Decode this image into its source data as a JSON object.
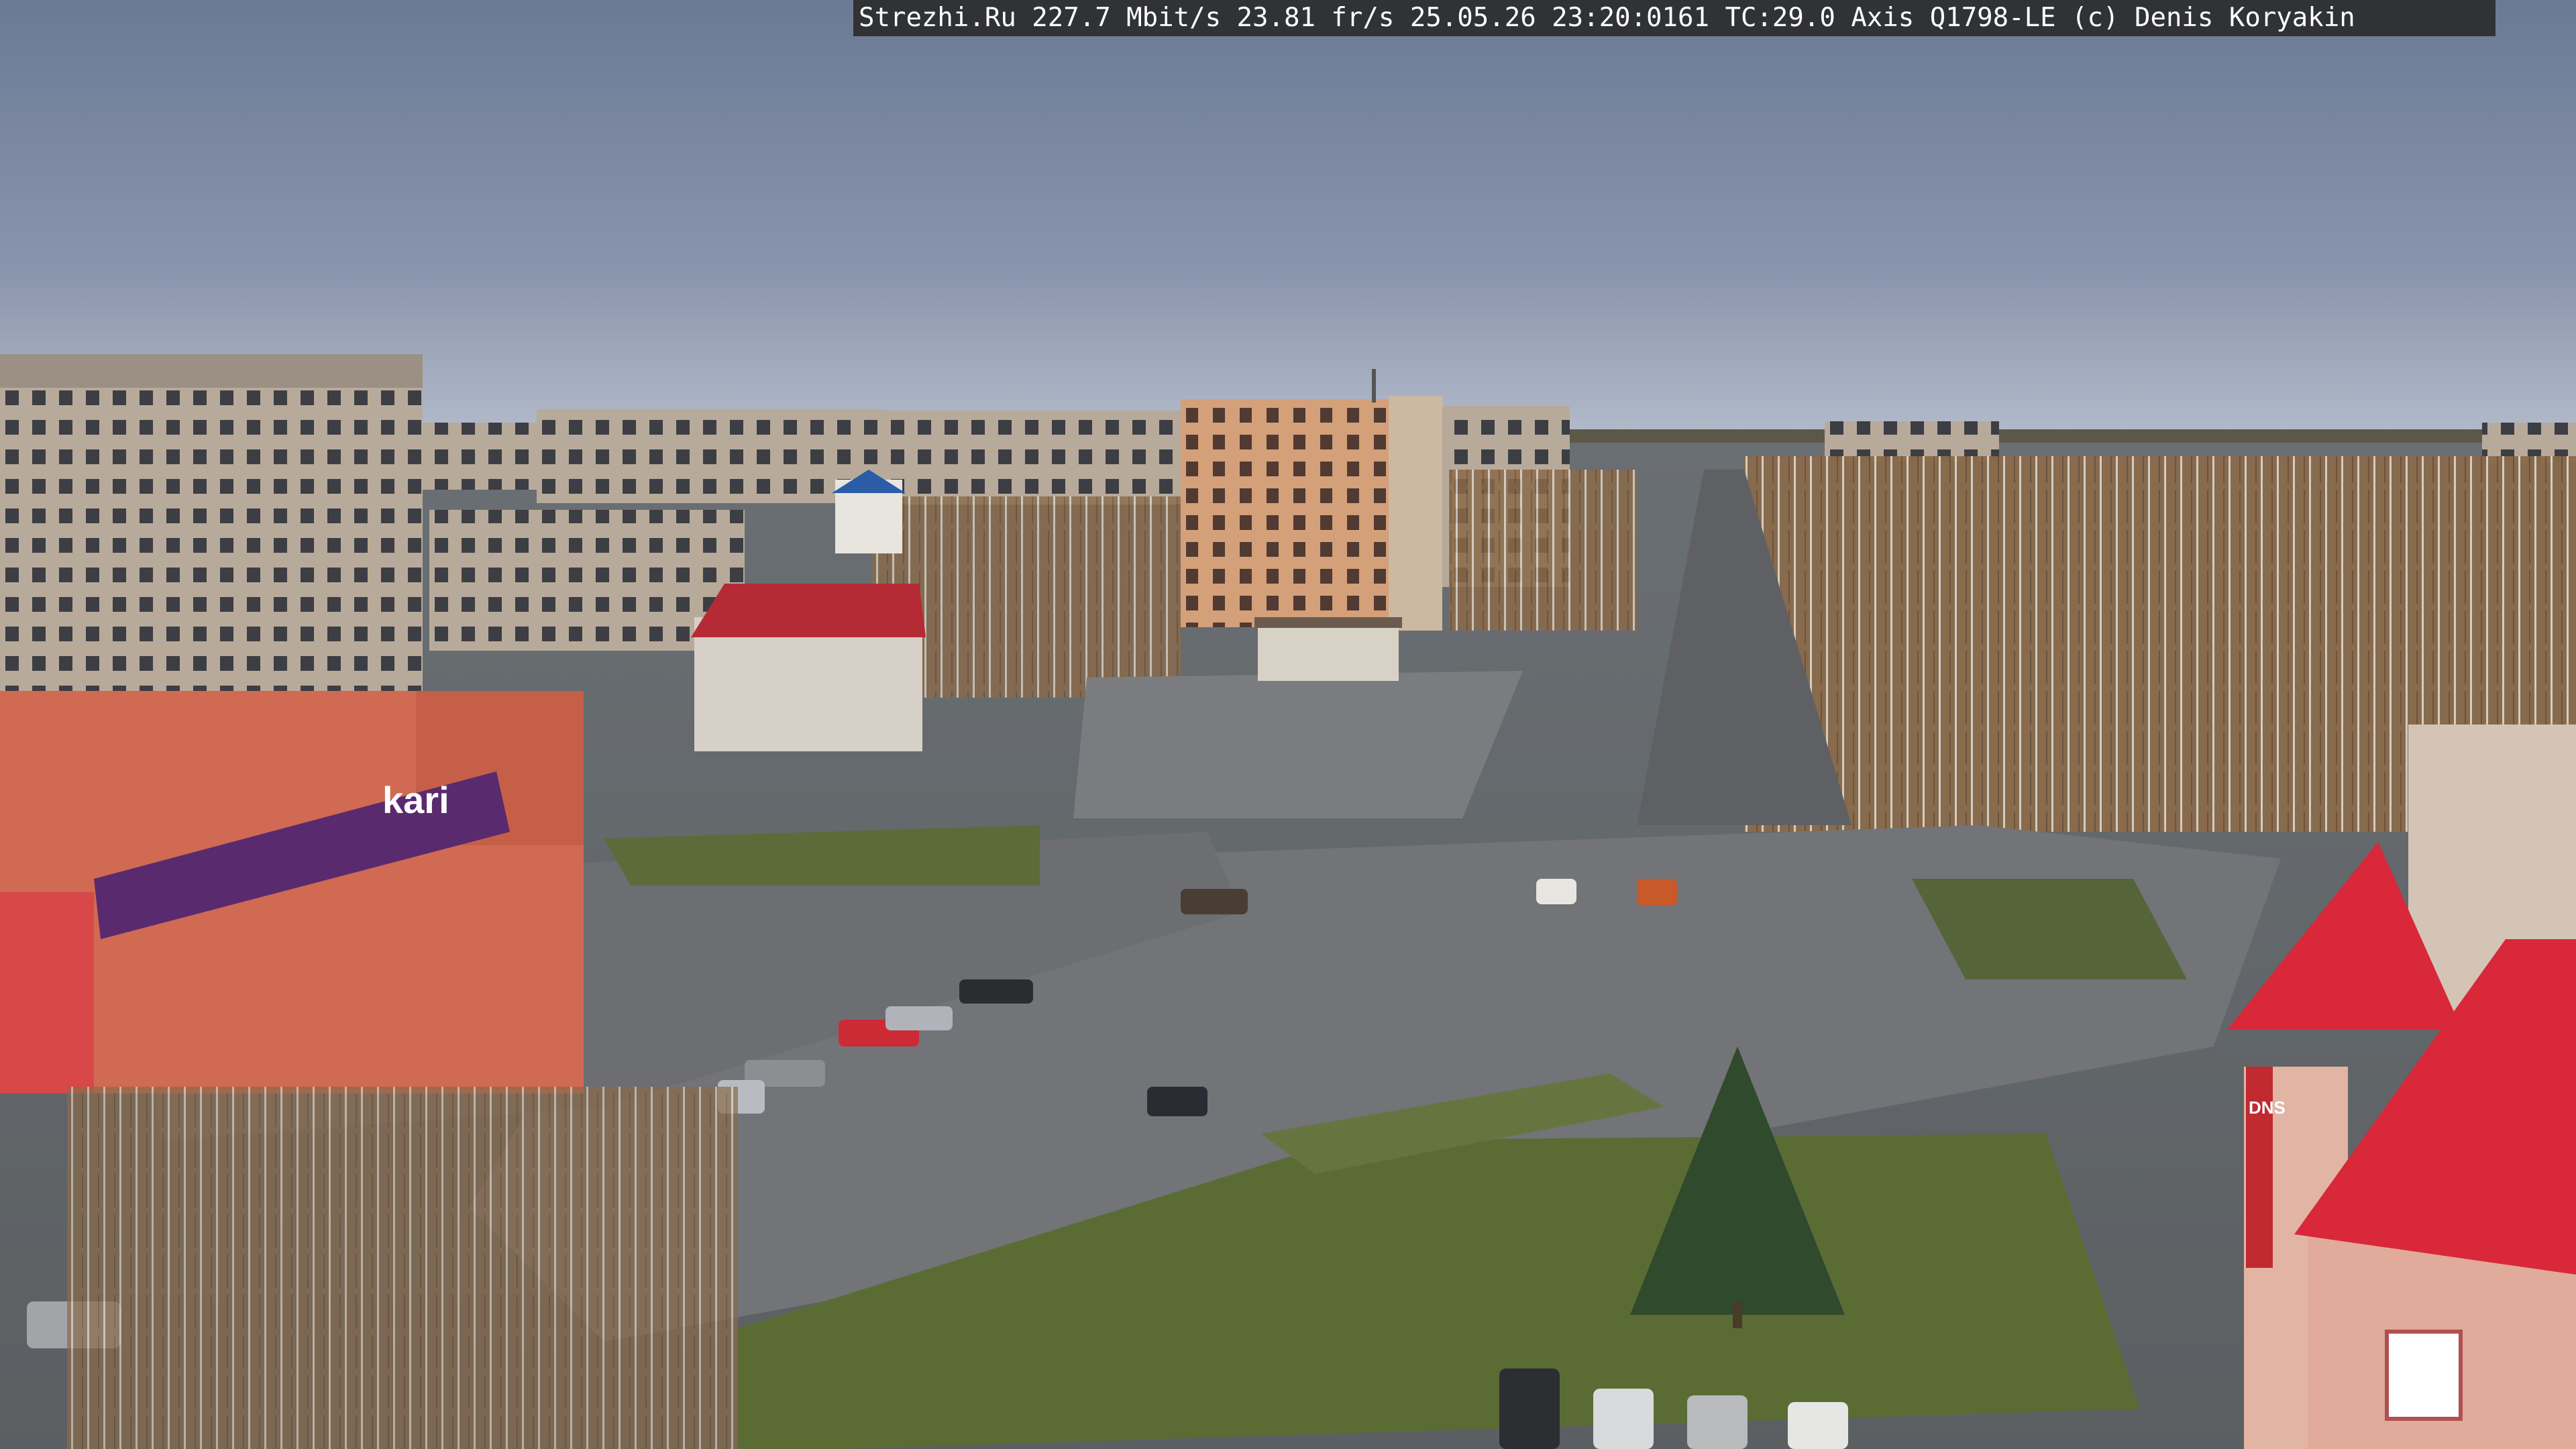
{
  "overlay": {
    "site": "Strezhi.Ru",
    "bitrate": "227.7 Mbit/s",
    "framerate": "23.81 fr/s",
    "date": "25.05.26",
    "time": "23:20:0161",
    "tc": "TC:29.0",
    "camera": "Axis Q1798-LE",
    "copyright": "(c) Denis Koryakin"
  },
  "storefront": {
    "brand": "kari"
  },
  "building_right": {
    "sign": "DNS"
  },
  "colors": {
    "sky_top": "#6c7a96",
    "sky_bottom": "#a6b0c4",
    "roof_red": "#d8283a",
    "storefront_purple": "#5a2a6e",
    "asphalt": "#6e7075",
    "grass": "#5c6a3a"
  }
}
